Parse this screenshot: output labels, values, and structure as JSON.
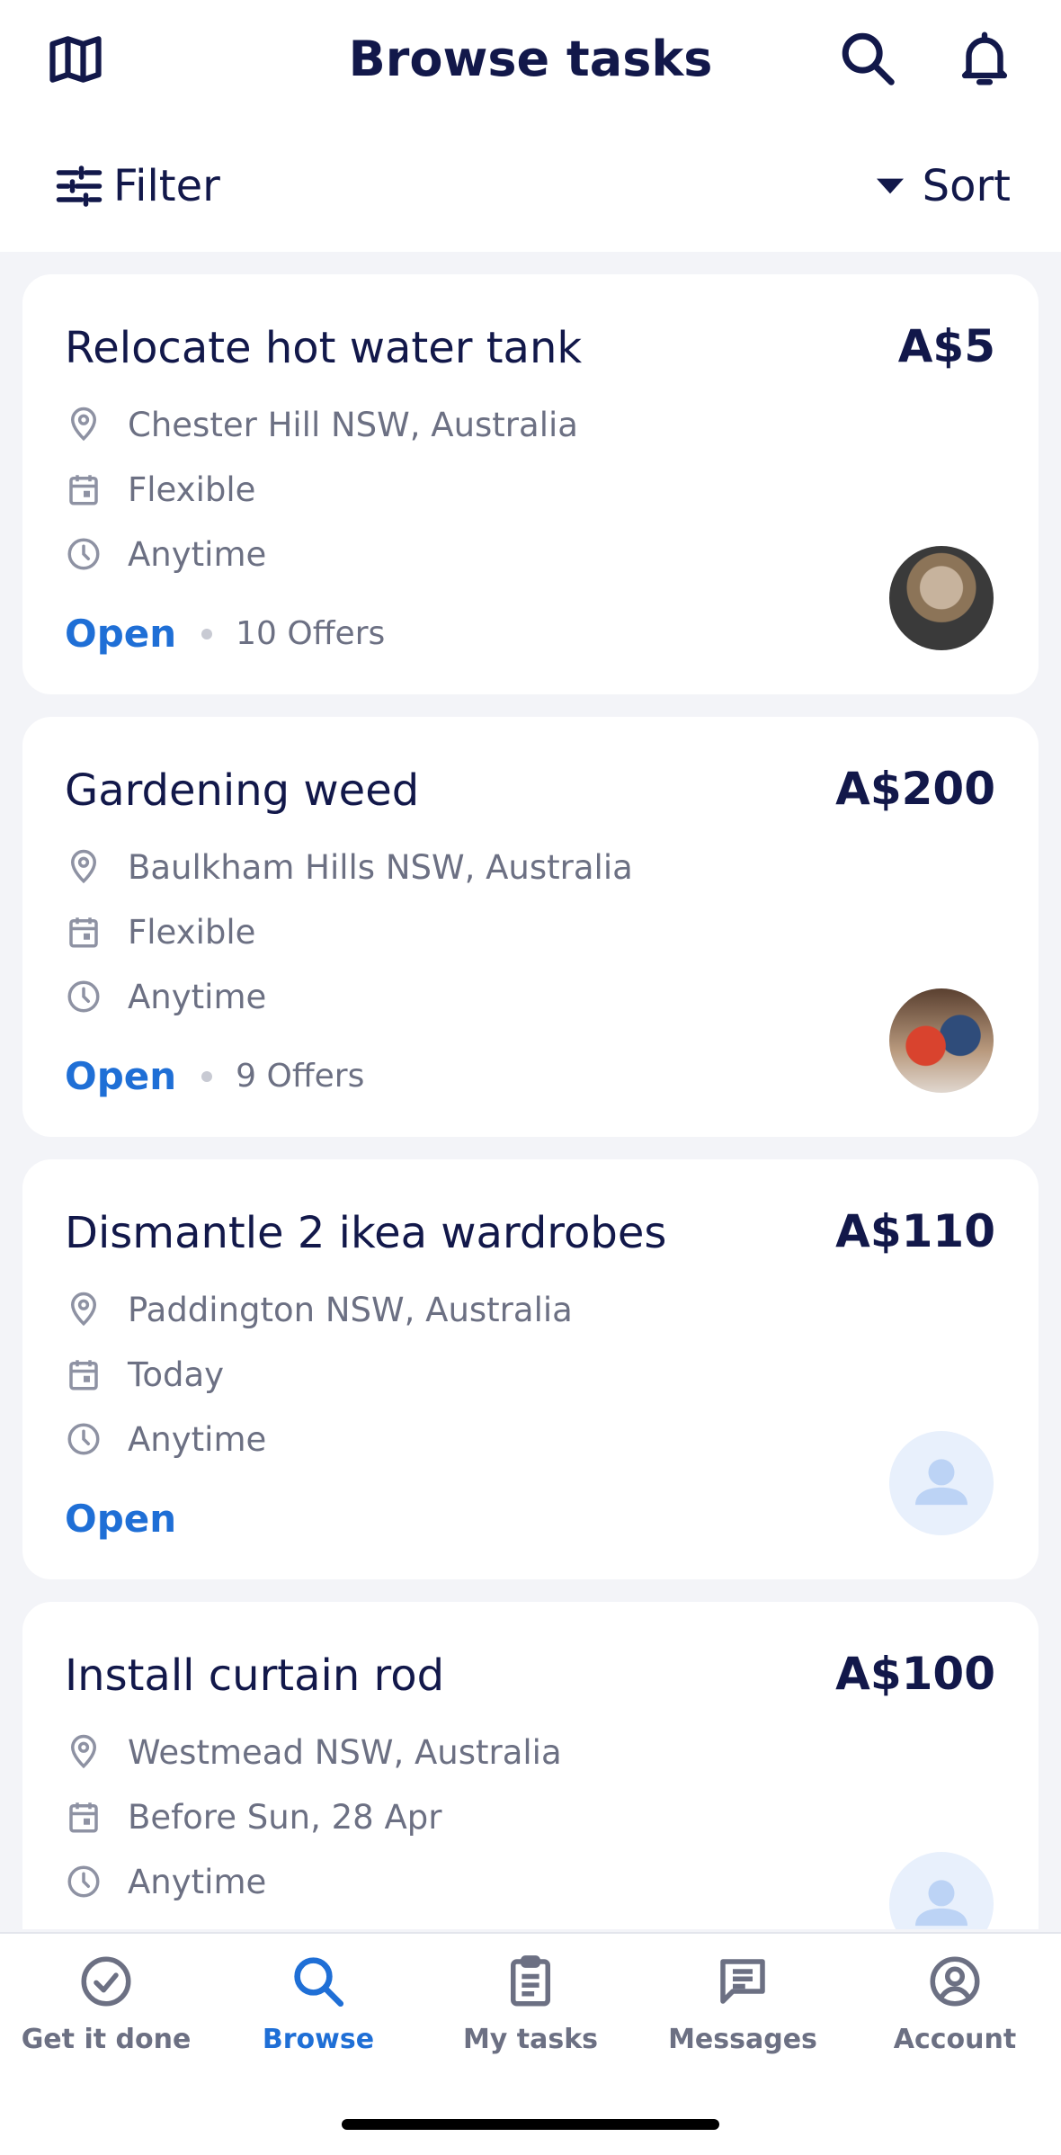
{
  "header": {
    "title": "Browse tasks",
    "filter_label": "Filter",
    "sort_label": "Sort"
  },
  "tasks": [
    {
      "title": "Relocate hot water tank",
      "price": "A$5",
      "location": "Chester Hill NSW, Australia",
      "date": "Flexible",
      "time": "Anytime",
      "status": "Open",
      "offers": "10 Offers",
      "avatar": "user-photo"
    },
    {
      "title": "Gardening weed",
      "price": "A$200",
      "location": "Baulkham Hills NSW, Australia",
      "date": "Flexible",
      "time": "Anytime",
      "status": "Open",
      "offers": "9 Offers",
      "avatar": "user-photo"
    },
    {
      "title": "Dismantle 2 ikea wardrobes",
      "price": "A$110",
      "location": "Paddington NSW, Australia",
      "date": "Today",
      "time": "Anytime",
      "status": "Open",
      "offers": "",
      "avatar": "placeholder"
    },
    {
      "title": "Install curtain rod",
      "price": "A$100",
      "location": "Westmead NSW, Australia",
      "date": "Before Sun, 28 Apr",
      "time": "Anytime",
      "status": "",
      "offers": "",
      "avatar": "placeholder"
    }
  ],
  "nav": {
    "items": [
      {
        "label": "Get it done",
        "icon": "check-circle-icon"
      },
      {
        "label": "Browse",
        "icon": "search-icon"
      },
      {
        "label": "My tasks",
        "icon": "clipboard-icon"
      },
      {
        "label": "Messages",
        "icon": "message-icon"
      },
      {
        "label": "Account",
        "icon": "account-icon"
      }
    ],
    "active": "Browse"
  },
  "colors": {
    "primary_text": "#12184a",
    "accent": "#1f6fd6",
    "muted": "#6c7083",
    "background": "#f3f4f8"
  }
}
